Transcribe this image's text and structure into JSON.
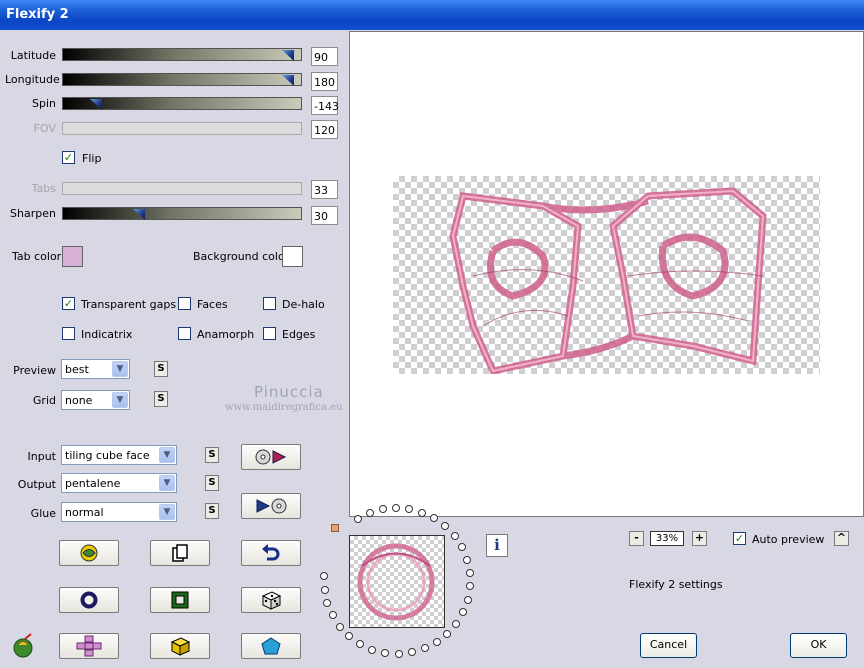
{
  "window": {
    "title": "Flexify 2"
  },
  "sliders": [
    {
      "label": "Latitude",
      "value": "90",
      "level": 0.97,
      "enabled": true
    },
    {
      "label": "Longitude",
      "value": "180",
      "level": 0.97,
      "enabled": true
    },
    {
      "label": "Spin",
      "value": "-143",
      "level": 0.12,
      "enabled": true
    },
    {
      "label": "FOV",
      "value": "120",
      "enabled": false
    },
    {
      "label": "Tabs",
      "value": "33",
      "enabled": false
    },
    {
      "label": "Sharpen",
      "value": "30",
      "level": 0.31,
      "enabled": true
    }
  ],
  "flip": {
    "label": "Flip",
    "checked": true
  },
  "colors": {
    "tab_color_label": "Tab color",
    "tab_color": "#d6b0d6",
    "background_color_label": "Background color",
    "background_color": "#ffffff"
  },
  "options": {
    "transparent_gaps": {
      "label": "Transparent gaps",
      "checked": true
    },
    "faces": {
      "label": "Faces",
      "checked": false
    },
    "dehalo": {
      "label": "De-halo",
      "checked": false
    },
    "indicatrix": {
      "label": "Indicatrix",
      "checked": false
    },
    "anamorph": {
      "label": "Anamorph",
      "checked": false
    },
    "edges": {
      "label": "Edges",
      "checked": false
    }
  },
  "preview_select": {
    "label": "Preview",
    "value": "best"
  },
  "grid_select": {
    "label": "Grid",
    "value": "none"
  },
  "input_select": {
    "label": "Input",
    "value": "tiling cube face"
  },
  "output_select": {
    "label": "Output",
    "value": "pentalene"
  },
  "glue_select": {
    "label": "Glue",
    "value": "normal"
  },
  "s_label": "S",
  "watermark": {
    "name": "Pinuccia",
    "url": "www.maidiregrafica.eu"
  },
  "zoom": {
    "value": "33%",
    "minus": "-",
    "plus": "+"
  },
  "auto_preview": {
    "label": "Auto preview",
    "checked": true,
    "button": "^"
  },
  "settings_name": "Flexify 2 settings",
  "info_label": "i",
  "buttons": {
    "cancel": "Cancel",
    "ok": "OK"
  }
}
